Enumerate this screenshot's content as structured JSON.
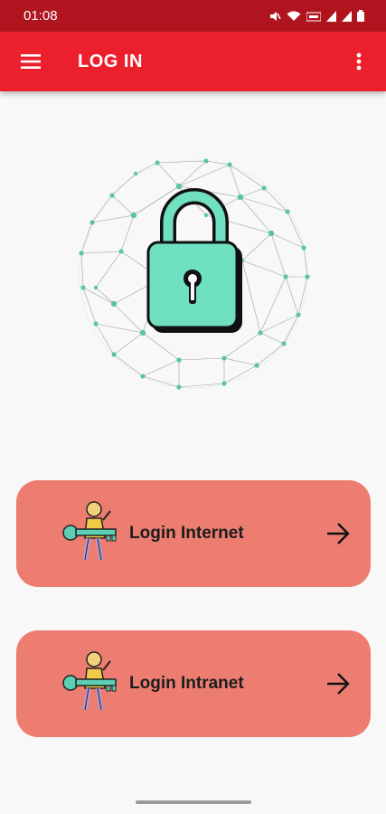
{
  "status_bar": {
    "time": "01:08",
    "icons": [
      "mute-icon",
      "wifi-icon",
      "volte-icon",
      "signal-icon",
      "signal-icon",
      "battery-icon"
    ]
  },
  "app_bar": {
    "title": "LOG IN",
    "menu_icon": "hamburger-menu-icon",
    "more_icon": "more-vertical-icon",
    "color": "#ec1f2d"
  },
  "hero": {
    "icon": "padlock-network-illustration",
    "lock_color": "#6fe0c0"
  },
  "login_options": [
    {
      "label": "Login Internet",
      "icon": "person-key-icon",
      "action_icon": "arrow-right-icon"
    },
    {
      "label": "Login Intranet",
      "icon": "person-key-icon",
      "action_icon": "arrow-right-icon"
    }
  ],
  "colors": {
    "status_bar": "#b0151f",
    "card": "#ed7d71",
    "background": "#f8f8f8"
  }
}
